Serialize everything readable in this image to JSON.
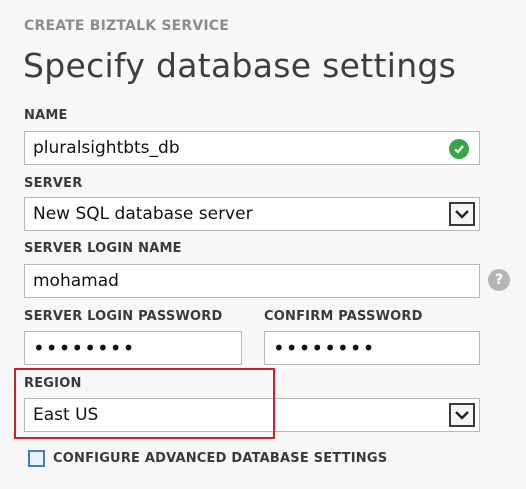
{
  "wizard": {
    "section": "CREATE BIZTALK SERVICE",
    "title": "Specify database settings"
  },
  "form": {
    "name_label": "NAME",
    "name_value": "pluralsightbts_db",
    "server_label": "SERVER",
    "server_value": "New SQL database server",
    "login_label": "SERVER LOGIN NAME",
    "login_value": "mohamad",
    "password_label": "SERVER LOGIN PASSWORD",
    "password_value": "••••••••",
    "confirm_label": "CONFIRM PASSWORD",
    "confirm_value": "••••••••",
    "region_label": "REGION",
    "region_value": "East US",
    "advanced_label": "CONFIGURE ADVANCED DATABASE SETTINGS"
  },
  "icons": {
    "valid": "check-circle-icon",
    "help": "question-circle-icon",
    "dropdown": "chevron-down-icon"
  },
  "colors": {
    "valid_green": "#3aa64a",
    "highlight_red": "#c8232c",
    "checkbox_blue": "#3a7ec5"
  }
}
